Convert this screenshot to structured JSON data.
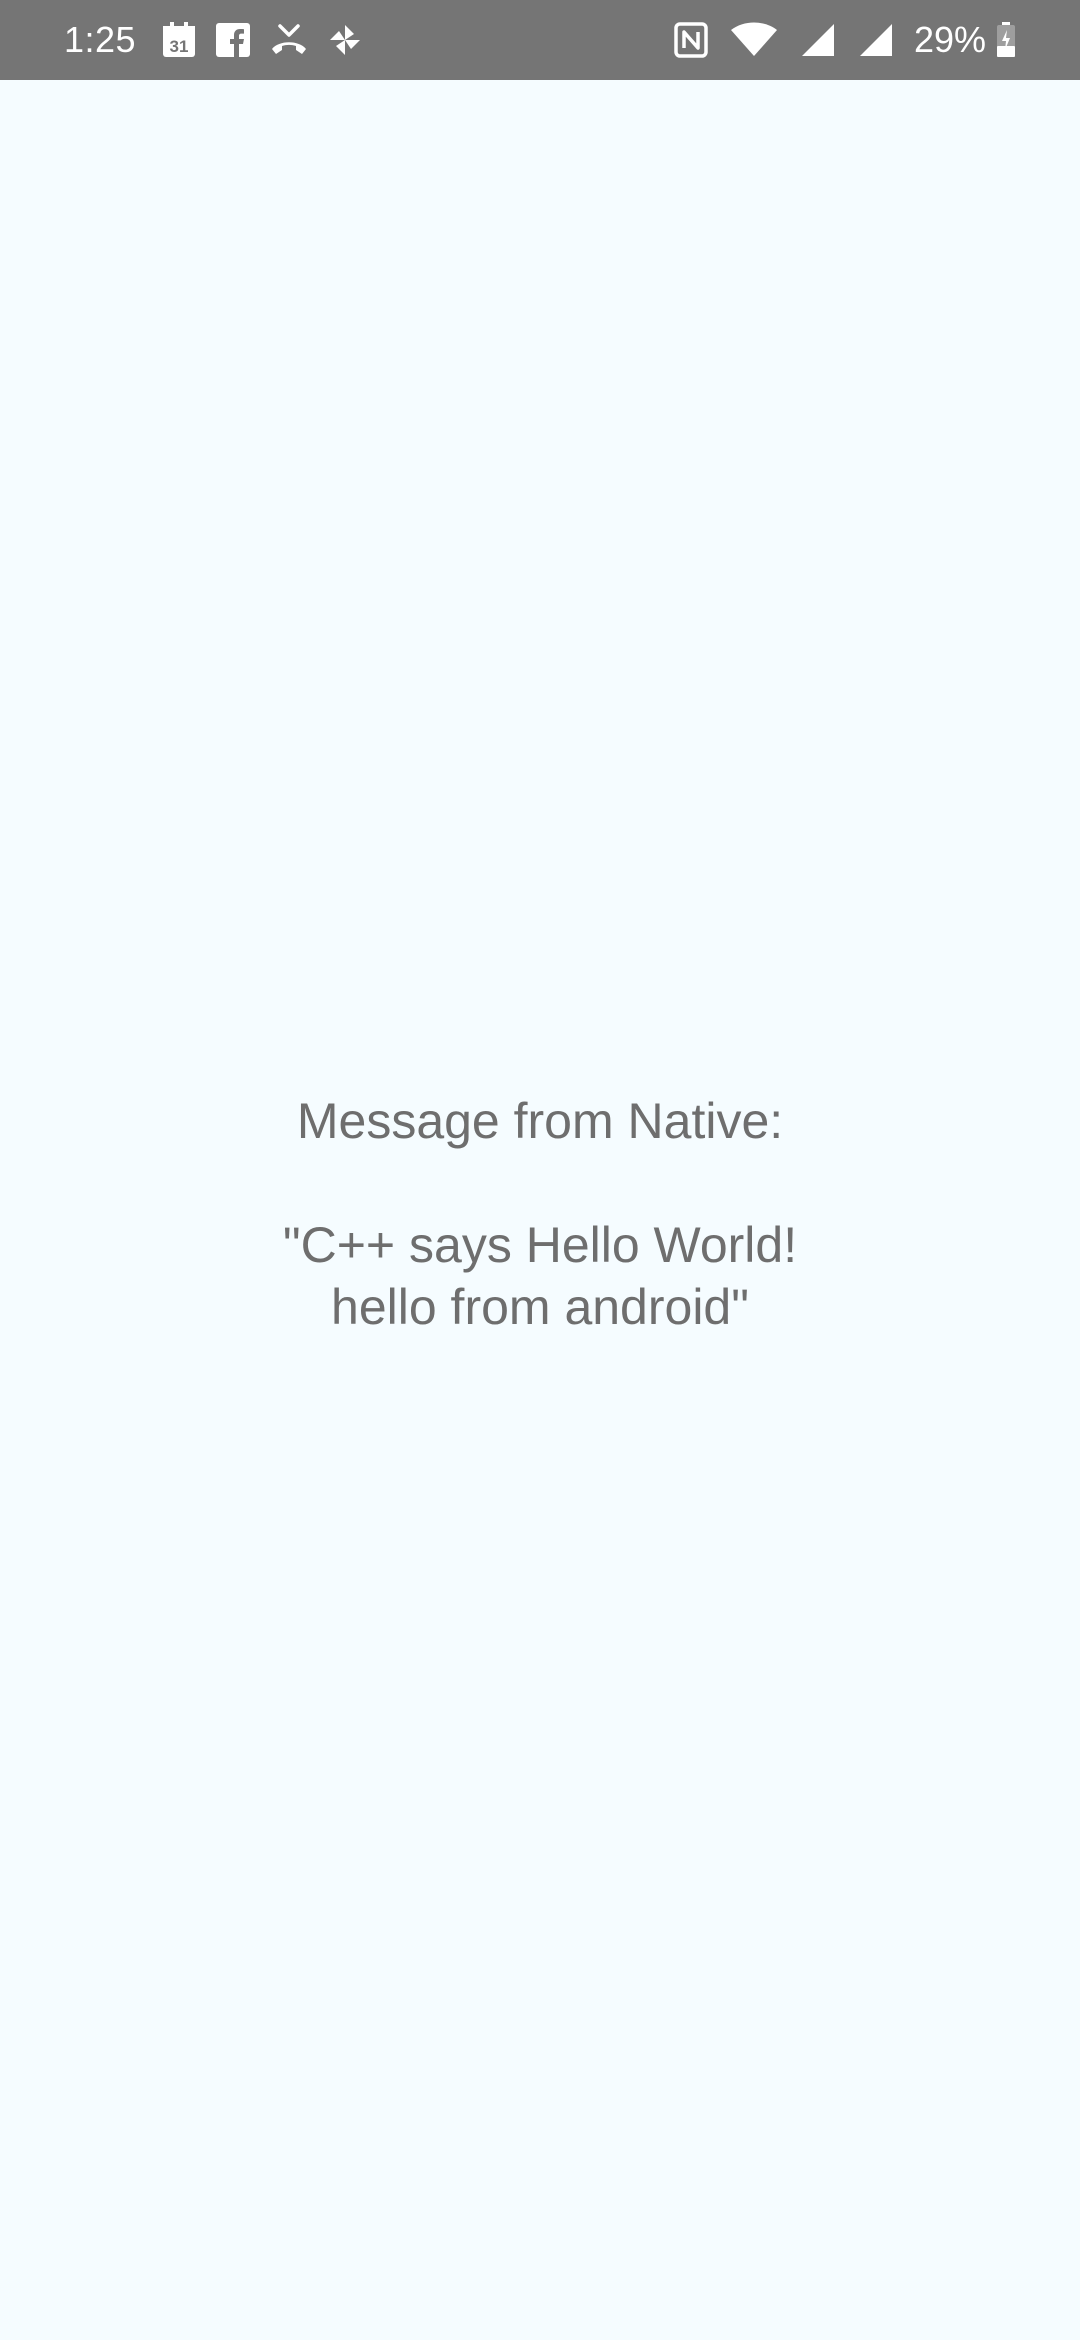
{
  "status_bar": {
    "time": "1:25",
    "left_icons": [
      "calendar-icon",
      "facebook-icon",
      "missed-call-icon",
      "pinwheel-icon"
    ],
    "calendar_day": "31",
    "right_icons": [
      "nfc-icon",
      "wifi-icon",
      "cell-signal-icon",
      "cell-signal-icon",
      "battery-icon"
    ],
    "battery_percent": "29%",
    "background_color": "#757575"
  },
  "app": {
    "background_color": "#F5FCFF",
    "text_color": "#6E6E6E",
    "message_title": "Message from Native:",
    "message_body": "\"C++ says Hello World!\nhello from android\""
  }
}
